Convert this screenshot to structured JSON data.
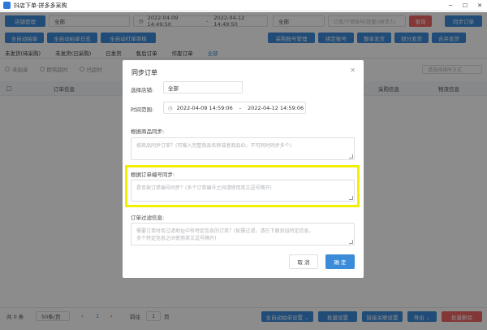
{
  "window": {
    "title": "抖店下单-拼多多采购",
    "minimize": "─",
    "maximize": "☐",
    "close": "✕"
  },
  "toolbar": {
    "store_button": "店铺管理",
    "store_select": "全部",
    "date_start": "2022-04-09 14:49:50",
    "date_sep": "-",
    "date_end": "2022-04-12 14:49:50",
    "status_select": "全部",
    "search_placeholder": "订单/下单账号(批量)/收货人/",
    "search_button": "查询",
    "sync_button": "同步订单"
  },
  "toolbar2": {
    "auto_purchase": "全自动拍单",
    "auto_purchase_log": "全自动拍单日志",
    "auto_review": "全自动打单审核",
    "purchase_account": "采购账号管理",
    "bind_account": "绑定账号",
    "ship": "整单发货",
    "partial_ship": "部分发货",
    "merge_ship": "合并发货"
  },
  "tabs": [
    "未发货(待采购)",
    "未发货(已采购)",
    "已发货",
    "售后订单",
    "作废订单",
    "全部"
  ],
  "radios": [
    "未拍单",
    "即将超时",
    "已超时"
  ],
  "table": {
    "col_order": "订单信息",
    "col_purchase": "采购信息",
    "col_logistics": "物流信息",
    "filter_placeholder": "请选择排序方式"
  },
  "bottom": {
    "total": "共 0 条",
    "page_size": "50条/页",
    "prev": "‹",
    "page": "1",
    "next": "›",
    "goto_label": "前往",
    "goto_value": "1",
    "goto_unit": "页",
    "auto_settings": "全自动拍单设置 ⌄",
    "batch_settings": "批量设置",
    "link_relate": "链接关联设置",
    "export": "导出 ⌄",
    "batch_delete": "批量删除"
  },
  "dialog": {
    "title": "同步订单",
    "close_icon": "✕",
    "store_label": "选择店铺:",
    "store_value": "全部",
    "time_label": "时间范围:",
    "time_start": "2022-04-09 14:59:06",
    "time_sep": "-",
    "time_end": "2022-04-12 14:59:06",
    "product_label": "根据商品同步:",
    "product_placeholder": "按商品同步订单？(可输入完整商品名称或者商品ID，不可同时同步多个)",
    "order_label": "根据订单编号同步:",
    "order_placeholder": "是否按订单编号同步？(多个订单编号之间请使用英文逗号隔开)",
    "filter_label": "订单过滤信息:",
    "filter_placeholder_line1": "需要订单时否过滤地址中有特定信息的订单？(如需过滤，请在下面添加特定信息，",
    "filter_placeholder_line2": "多个特定信息之间使用英文逗号隔开)",
    "cancel": "取 消",
    "confirm": "确 定"
  },
  "colors": {
    "primary": "#3c8bd9",
    "danger": "#f06464",
    "highlight": "#f2f000"
  }
}
